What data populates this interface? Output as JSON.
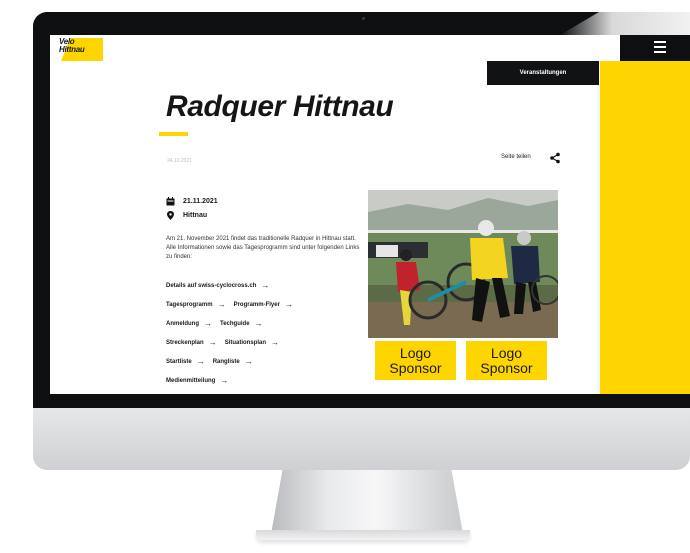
{
  "site": {
    "logo_text": "Velo Club Hittnau"
  },
  "nav": {
    "events_tab": "Veranstaltungen",
    "menu_icon": "menu-icon"
  },
  "page": {
    "title": "Radquer Hittnau",
    "published_date": "24.10.2021",
    "share_label": "Seite teilen",
    "event_date": "21.11.2021",
    "event_location": "Hittnau",
    "intro": "Am 21. November 2021 findet das traditionelle Radquer in Hittnau statt. Alle Informationen sowie das Tagesprogramm sind unter folgenden Links zu finden:"
  },
  "links": [
    [
      "Details auf swiss-cyclocross.ch"
    ],
    [
      "Tagesprogramm",
      "Programm-Flyer"
    ],
    [
      "Anmeldung",
      "Techguide"
    ],
    [
      "Streckenplan",
      "Situationsplan"
    ],
    [
      "Startliste",
      "Rangliste"
    ],
    [
      "Medienmitteilung"
    ]
  ],
  "link_arrow": "→",
  "sponsors": [
    {
      "line1": "Logo",
      "line2": "Sponsor"
    },
    {
      "line1": "Logo",
      "line2": "Sponsor"
    }
  ],
  "colors": {
    "accent": "#ffd500",
    "dark": "#111214",
    "bezel": "#0e0f11"
  },
  "icons": [
    "calendar-icon",
    "location-pin-icon",
    "share-icon",
    "arrow-right-icon",
    "menu-icon"
  ]
}
